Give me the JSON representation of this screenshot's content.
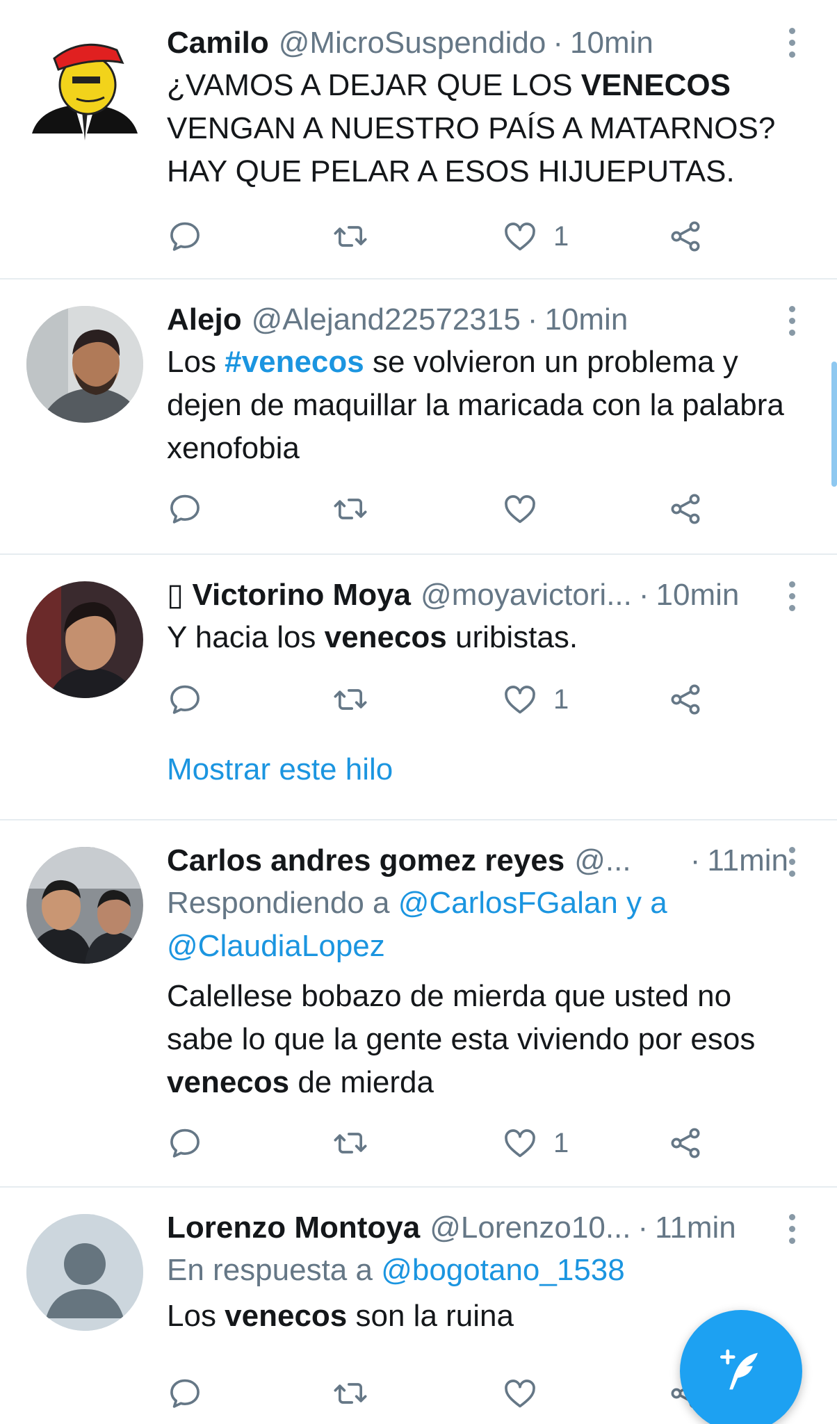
{
  "icons": {
    "reply": "reply-icon",
    "retweet": "retweet-icon",
    "like": "heart-icon",
    "share": "share-icon",
    "more": "more-vertical-icon",
    "compose": "compose-tweet-icon"
  },
  "colors": {
    "link": "#1b95e0",
    "muted": "#657786",
    "text": "#14171a",
    "fab": "#1da1f2",
    "divider": "#e6ecf0"
  },
  "tweets": [
    {
      "name": "Camilo",
      "handle": "@MicroSuspendido",
      "time": "10min",
      "text_parts": [
        "¿VAMOS A DEJAR QUE LOS ",
        "VENECOS",
        " VENGAN A NUESTRO PAÍS A MATARNOS? HAY QUE PELAR A ESOS HIJUEPUTAS."
      ],
      "likes": "1"
    },
    {
      "name": "Alejo",
      "handle": "@Alejand22572315",
      "time": "10min",
      "text_parts": [
        "Los ",
        "#venecos",
        " se volvieron un problema y dejen de maquillar la maricada con la palabra xenofobia"
      ],
      "likes": ""
    },
    {
      "name_prefix": "▯",
      "name": "Victorino Moya",
      "handle": "@moyavictori...",
      "time": "10min",
      "text_parts": [
        "Y hacia los ",
        "venecos",
        " uribistas."
      ],
      "likes": "1",
      "show_thread": "Mostrar este hilo"
    },
    {
      "name": "Carlos andres gomez reyes",
      "handle": "@...",
      "time": "11min",
      "reply_prefix": "Respondiendo a ",
      "reply_mention1": "@CarlosFGalan",
      "reply_join": " y a",
      "reply_mention2": "@ClaudiaLopez",
      "text_parts": [
        "Calellese bobazo de mierda que usted no sabe lo que la gente esta viviendo por esos ",
        "venecos",
        " de mierda"
      ],
      "likes": "1"
    },
    {
      "name": "Lorenzo Montoya",
      "handle": "@Lorenzo10...",
      "time": "11min",
      "reply_prefix": "En respuesta a ",
      "reply_mention1": "@bogotano_1538",
      "text_parts": [
        "Los ",
        "venecos",
        " son la ruina"
      ],
      "likes": ""
    }
  ],
  "separator_dot": "·"
}
